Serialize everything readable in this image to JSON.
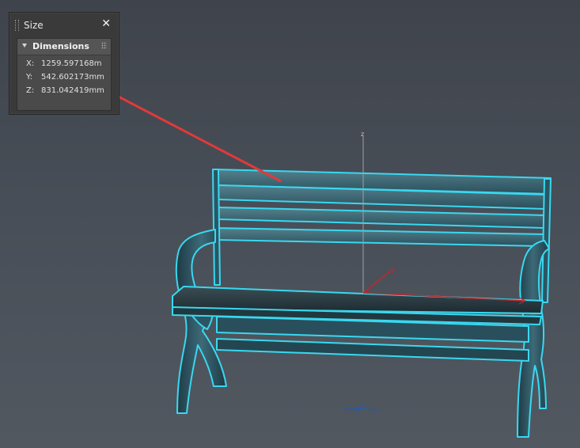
{
  "panel": {
    "title": "Size",
    "close_glyph": "✕",
    "section_title": "Dimensions",
    "dimensions": [
      {
        "label": "X:",
        "value": "1259.597168m"
      },
      {
        "label": "Y:",
        "value": "542.602173mm"
      },
      {
        "label": "Z:",
        "value": "831.042419mm"
      }
    ]
  },
  "gizmo": {
    "z_label": "z",
    "y_label": "y"
  },
  "colors": {
    "highlight_outline": "#39d8f0",
    "bench_fill": "#2f5a68",
    "annotation_arrow": "#e03a3a",
    "axis_x": "#c0282c",
    "axis_z": "#a0a0a0",
    "ground_marker": "#2a5aa8"
  },
  "icons": {
    "close": "close-icon",
    "collapse": "collapse-arrow-icon",
    "drag": "drag-handle-icon"
  }
}
